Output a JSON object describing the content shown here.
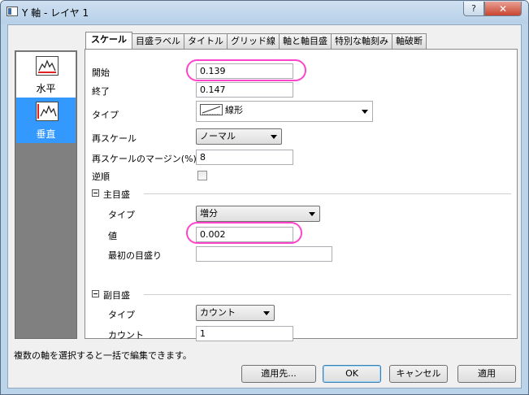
{
  "window": {
    "title": "Y 軸 - レイヤ 1",
    "help_label": "?",
    "close_label": "✕"
  },
  "sidebar": {
    "items": [
      {
        "label": "水平",
        "icon": "x-axis-icon"
      },
      {
        "label": "垂直",
        "icon": "y-axis-icon"
      }
    ]
  },
  "tabs": [
    "スケール",
    "目盛ラベル",
    "タイトル",
    "グリッド線",
    "軸と軸目盛",
    "特別な軸刻み",
    "軸破断"
  ],
  "scale": {
    "start_label": "開始",
    "start_value": "0.139",
    "end_label": "終了",
    "end_value": "0.147",
    "type_label": "タイプ",
    "type_value": "線形",
    "rescale_label": "再スケール",
    "rescale_value": "ノーマル",
    "margin_label": "再スケールのマージン(%)",
    "margin_value": "8",
    "reverse_label": "逆順"
  },
  "major": {
    "group_label": "主目盛",
    "type_label": "タイプ",
    "type_value": "増分",
    "value_label": "値",
    "value_value": "0.002",
    "first_label": "最初の目盛り",
    "first_value": ""
  },
  "minor": {
    "group_label": "副目盛",
    "type_label": "タイプ",
    "type_value": "カウント",
    "count_label": "カウント",
    "count_value": "1"
  },
  "status": "複数の軸を選択すると一括で編集できます。",
  "buttons": {
    "apply_to": "適用先...",
    "ok": "OK",
    "cancel": "キャンセル",
    "apply": "適用"
  },
  "colors": {
    "highlight": "#ff44cc",
    "selection": "#3399ff"
  }
}
